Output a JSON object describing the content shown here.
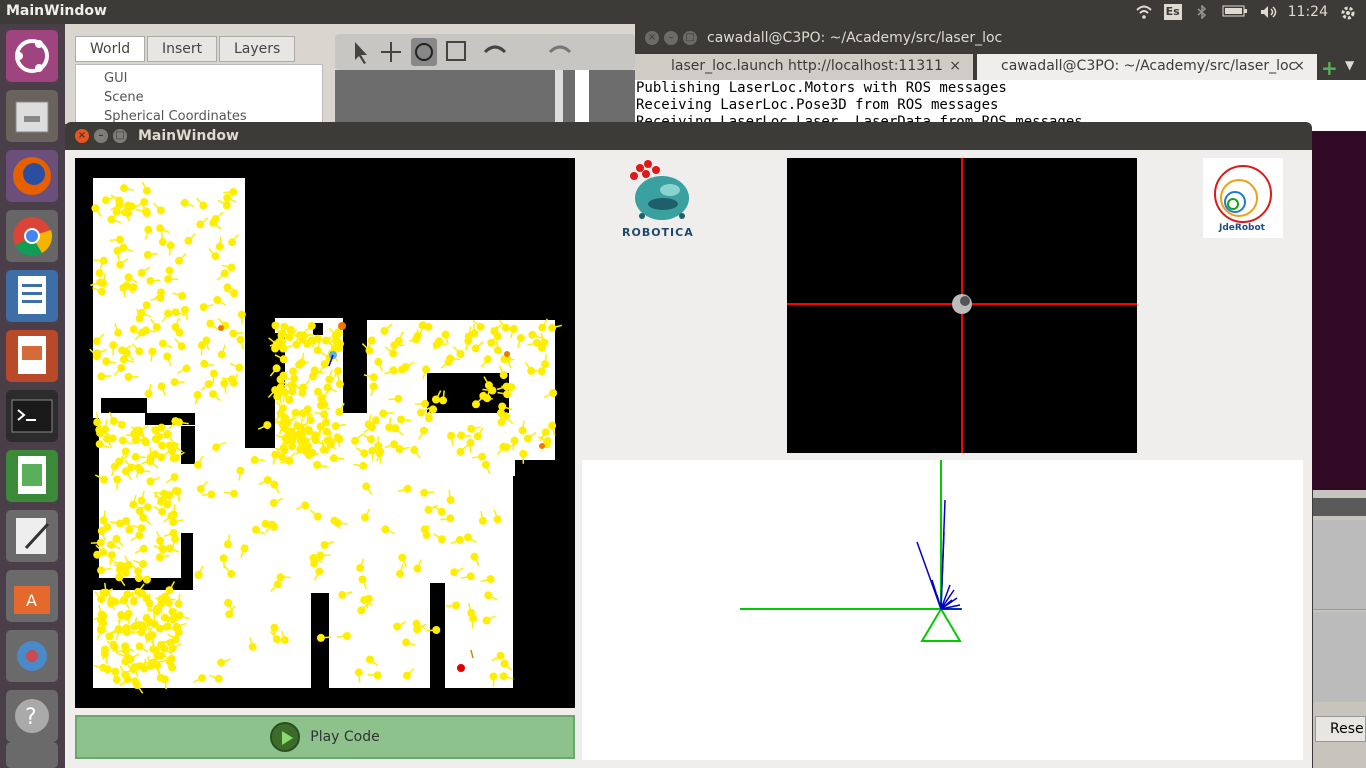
{
  "topbar": {
    "title": "MainWindow",
    "keyboard": "Es",
    "time": "11:24",
    "icons": [
      "wifi-icon",
      "keyboard-layout-icon",
      "bluetooth-icon",
      "battery-icon",
      "volume-icon",
      "gear-icon"
    ]
  },
  "launcher": {
    "items": [
      "ubuntu-dash",
      "files",
      "firefox",
      "chrome",
      "writer",
      "impress",
      "terminal",
      "calc",
      "text-editor",
      "software-center",
      "system-settings",
      "help",
      "trash"
    ]
  },
  "gazebo": {
    "tabs": [
      "World",
      "Insert",
      "Layers"
    ],
    "tree": [
      "GUI",
      "Scene",
      "Spherical Coordinates"
    ]
  },
  "terminal": {
    "title": "cawadall@C3PO: ~/Academy/src/laser_loc",
    "tabs": [
      "laser_loc.launch http://localhost:11311",
      "cawadall@C3PO: ~/Academy/src/laser_loc"
    ],
    "lines": [
      "Publishing LaserLoc.Motors with ROS messages",
      "Receiving LaserLoc.Pose3D from ROS messages",
      "Receiving LaserLoc.Laser  LaserData from ROS messages"
    ]
  },
  "mainwindow": {
    "title": "MainWindow",
    "play_label": "Play Code",
    "logo_text": "ROBOTICA",
    "jde_text": "JdeRobot"
  },
  "side_text": "Rese",
  "colors": {
    "particle": "#ffee00",
    "laser_beam": "#0000cc",
    "axis": "#00cc00",
    "cam_cross": "#ff0000",
    "play_bg": "#8dc28d"
  }
}
